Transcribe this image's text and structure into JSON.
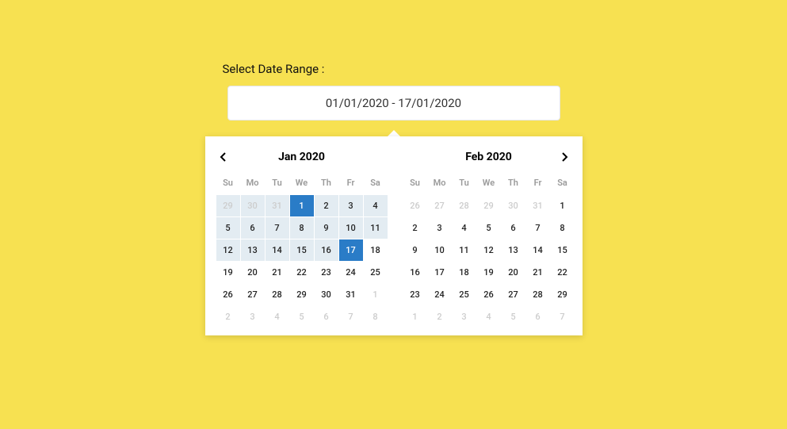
{
  "label": "Select Date Range :",
  "input_value": "01/01/2020 - 17/01/2020",
  "weekday_headers": [
    "Su",
    "Mo",
    "Tu",
    "We",
    "Th",
    "Fr",
    "Sa"
  ],
  "calendars": [
    {
      "title": "Jan 2020",
      "days": [
        {
          "n": "29",
          "cls": "off range"
        },
        {
          "n": "30",
          "cls": "off range"
        },
        {
          "n": "31",
          "cls": "off range"
        },
        {
          "n": "1",
          "cls": "active"
        },
        {
          "n": "2",
          "cls": "range"
        },
        {
          "n": "3",
          "cls": "range"
        },
        {
          "n": "4",
          "cls": "range"
        },
        {
          "n": "5",
          "cls": "range"
        },
        {
          "n": "6",
          "cls": "range"
        },
        {
          "n": "7",
          "cls": "range"
        },
        {
          "n": "8",
          "cls": "range"
        },
        {
          "n": "9",
          "cls": "range"
        },
        {
          "n": "10",
          "cls": "range"
        },
        {
          "n": "11",
          "cls": "range"
        },
        {
          "n": "12",
          "cls": "range"
        },
        {
          "n": "13",
          "cls": "range"
        },
        {
          "n": "14",
          "cls": "range"
        },
        {
          "n": "15",
          "cls": "range"
        },
        {
          "n": "16",
          "cls": "range"
        },
        {
          "n": "17",
          "cls": "active"
        },
        {
          "n": "18",
          "cls": ""
        },
        {
          "n": "19",
          "cls": ""
        },
        {
          "n": "20",
          "cls": ""
        },
        {
          "n": "21",
          "cls": ""
        },
        {
          "n": "22",
          "cls": ""
        },
        {
          "n": "23",
          "cls": ""
        },
        {
          "n": "24",
          "cls": ""
        },
        {
          "n": "25",
          "cls": ""
        },
        {
          "n": "26",
          "cls": ""
        },
        {
          "n": "27",
          "cls": ""
        },
        {
          "n": "28",
          "cls": ""
        },
        {
          "n": "29",
          "cls": ""
        },
        {
          "n": "30",
          "cls": ""
        },
        {
          "n": "31",
          "cls": ""
        },
        {
          "n": "1",
          "cls": "off"
        },
        {
          "n": "2",
          "cls": "off"
        },
        {
          "n": "3",
          "cls": "off"
        },
        {
          "n": "4",
          "cls": "off"
        },
        {
          "n": "5",
          "cls": "off"
        },
        {
          "n": "6",
          "cls": "off"
        },
        {
          "n": "7",
          "cls": "off"
        },
        {
          "n": "8",
          "cls": "off"
        }
      ]
    },
    {
      "title": "Feb 2020",
      "days": [
        {
          "n": "26",
          "cls": "off"
        },
        {
          "n": "27",
          "cls": "off"
        },
        {
          "n": "28",
          "cls": "off"
        },
        {
          "n": "29",
          "cls": "off"
        },
        {
          "n": "30",
          "cls": "off"
        },
        {
          "n": "31",
          "cls": "off"
        },
        {
          "n": "1",
          "cls": ""
        },
        {
          "n": "2",
          "cls": ""
        },
        {
          "n": "3",
          "cls": ""
        },
        {
          "n": "4",
          "cls": ""
        },
        {
          "n": "5",
          "cls": ""
        },
        {
          "n": "6",
          "cls": ""
        },
        {
          "n": "7",
          "cls": ""
        },
        {
          "n": "8",
          "cls": ""
        },
        {
          "n": "9",
          "cls": ""
        },
        {
          "n": "10",
          "cls": ""
        },
        {
          "n": "11",
          "cls": ""
        },
        {
          "n": "12",
          "cls": ""
        },
        {
          "n": "13",
          "cls": ""
        },
        {
          "n": "14",
          "cls": ""
        },
        {
          "n": "15",
          "cls": ""
        },
        {
          "n": "16",
          "cls": ""
        },
        {
          "n": "17",
          "cls": ""
        },
        {
          "n": "18",
          "cls": ""
        },
        {
          "n": "19",
          "cls": ""
        },
        {
          "n": "20",
          "cls": ""
        },
        {
          "n": "21",
          "cls": ""
        },
        {
          "n": "22",
          "cls": ""
        },
        {
          "n": "23",
          "cls": ""
        },
        {
          "n": "24",
          "cls": ""
        },
        {
          "n": "25",
          "cls": ""
        },
        {
          "n": "26",
          "cls": ""
        },
        {
          "n": "27",
          "cls": ""
        },
        {
          "n": "28",
          "cls": ""
        },
        {
          "n": "29",
          "cls": ""
        },
        {
          "n": "1",
          "cls": "off"
        },
        {
          "n": "2",
          "cls": "off"
        },
        {
          "n": "3",
          "cls": "off"
        },
        {
          "n": "4",
          "cls": "off"
        },
        {
          "n": "5",
          "cls": "off"
        },
        {
          "n": "6",
          "cls": "off"
        },
        {
          "n": "7",
          "cls": "off"
        }
      ]
    }
  ]
}
